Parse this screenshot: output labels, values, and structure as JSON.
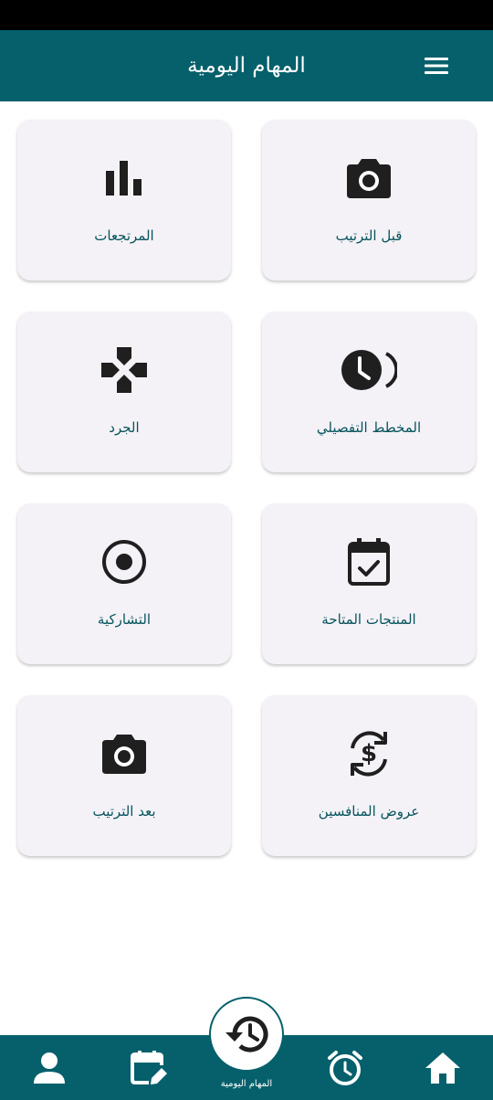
{
  "header": {
    "title": "المهام اليومية",
    "menu_icon": "menu-icon"
  },
  "tiles": [
    {
      "label": "قبل الترتيب",
      "icon": "camera-icon"
    },
    {
      "label": "المرتجعات",
      "icon": "bar-chart-icon"
    },
    {
      "label": "المخطط التفصيلي",
      "icon": "clock-icon"
    },
    {
      "label": "الجرد",
      "icon": "gamepad-icon"
    },
    {
      "label": "المنتجات المتاحة",
      "icon": "calendar-check-icon"
    },
    {
      "label": "التشاركية",
      "icon": "radio-button-icon"
    },
    {
      "label": "عروض المنافسين",
      "icon": "currency-exchange-icon"
    },
    {
      "label": "بعد الترتيب",
      "icon": "camera-icon"
    }
  ],
  "bottom_nav": {
    "items": [
      {
        "icon": "home-icon"
      },
      {
        "icon": "alarm-icon"
      },
      {
        "icon": "history-icon",
        "label": "المهام اليومية",
        "selected": true
      },
      {
        "icon": "edit-calendar-icon"
      },
      {
        "icon": "person-icon"
      }
    ]
  },
  "colors": {
    "primary": "#05606b",
    "card_background": "#f4f2f7",
    "label_text": "#06545d",
    "icon": "#1f1f1f"
  }
}
